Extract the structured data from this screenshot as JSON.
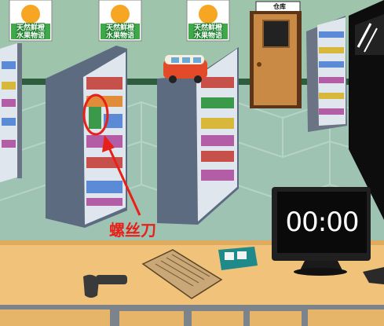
{
  "scene": {
    "posters": [
      {
        "text_top": "天然鲜橙",
        "text_bottom": "水果物语"
      },
      {
        "text_top": "天然鲜橙",
        "text_bottom": "水果物语"
      },
      {
        "text_top": "天然鲜橙",
        "text_bottom": "水果物语"
      }
    ],
    "door_sign": "仓库",
    "clock_display": "00:00",
    "annotation_label": "螺丝刀",
    "highlighted_item": "screwdriver",
    "colors": {
      "wall": "#9ec4ac",
      "floor": "#9fc3b3",
      "counter": "#f0c27a",
      "annotation": "#e8201a",
      "door": "#c98a45"
    }
  }
}
